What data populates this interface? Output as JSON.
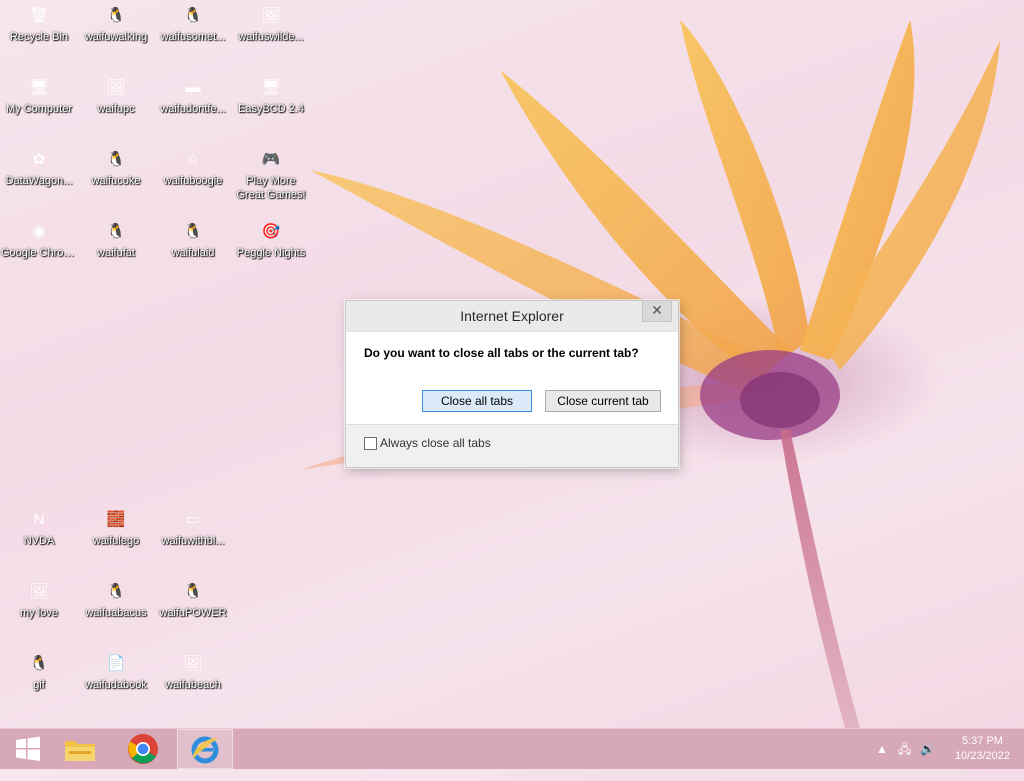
{
  "desktop": {
    "icons": [
      {
        "label": "Recycle Bin",
        "glyph": "🗑",
        "icon": "recycle-bin-icon"
      },
      {
        "label": "waifuwalking",
        "glyph": "🐧",
        "icon": "penguin-icon"
      },
      {
        "label": "waifusomet...",
        "glyph": "🐧",
        "icon": "penguin-icon"
      },
      {
        "label": "waifuswilde...",
        "glyph": "🖼",
        "icon": "image-icon"
      },
      {
        "label": "My Computer",
        "glyph": "🖥",
        "icon": "computer-icon"
      },
      {
        "label": "waifupc",
        "glyph": "🖼",
        "icon": "image-icon"
      },
      {
        "label": "waifudontfe...",
        "glyph": "▬",
        "icon": "image-icon"
      },
      {
        "label": "EasyBCD 2.4",
        "glyph": "🖥",
        "icon": "easybcd-icon"
      },
      {
        "label": "DataWagon...",
        "glyph": "✿",
        "icon": "datawagon-icon"
      },
      {
        "label": "waifucoke",
        "glyph": "🐧",
        "icon": "penguin-icon"
      },
      {
        "label": "waifuboogie",
        "glyph": "☆",
        "icon": "image-icon"
      },
      {
        "label": "Play More Great Games!",
        "glyph": "🎮",
        "icon": "games-icon"
      },
      {
        "label": "Google Chrome",
        "glyph": "◉",
        "icon": "chrome-icon"
      },
      {
        "label": "waifufat",
        "glyph": "🐧",
        "icon": "penguin-icon"
      },
      {
        "label": "waifulaid",
        "glyph": "🐧",
        "icon": "penguin-icon"
      },
      {
        "label": "Peggle Nights",
        "glyph": "🎯",
        "icon": "peggle-icon"
      },
      {
        "label": "NVDA",
        "glyph": "N",
        "icon": "nvda-icon"
      },
      {
        "label": "waifulego",
        "glyph": "🧱",
        "icon": "image-icon"
      },
      {
        "label": "waifuwithbl...",
        "glyph": "▭",
        "icon": "image-icon"
      },
      {
        "label": "my love",
        "glyph": "🖼",
        "icon": "image-icon"
      },
      {
        "label": "waifuabacus",
        "glyph": "🐧",
        "icon": "penguin-icon"
      },
      {
        "label": "waifuPOWER",
        "glyph": "🐧",
        "icon": "penguin-icon"
      },
      {
        "label": "gif",
        "glyph": "🐧",
        "icon": "penguin-icon"
      },
      {
        "label": "waifudabook",
        "glyph": "📄",
        "icon": "document-icon"
      },
      {
        "label": "waifubeach",
        "glyph": "🖼",
        "icon": "image-icon"
      }
    ]
  },
  "dialog": {
    "title": "Internet Explorer",
    "close_glyph": "✕",
    "question": "Do you want to close all tabs or the current tab?",
    "close_all_label": "Close all tabs",
    "close_current_label": "Close current tab",
    "always_close_label": "Always close all tabs",
    "always_close_checked": false
  },
  "taskbar": {
    "time": "5:37 PM",
    "date": "10/23/2022",
    "accent": "#d7a8b8"
  }
}
